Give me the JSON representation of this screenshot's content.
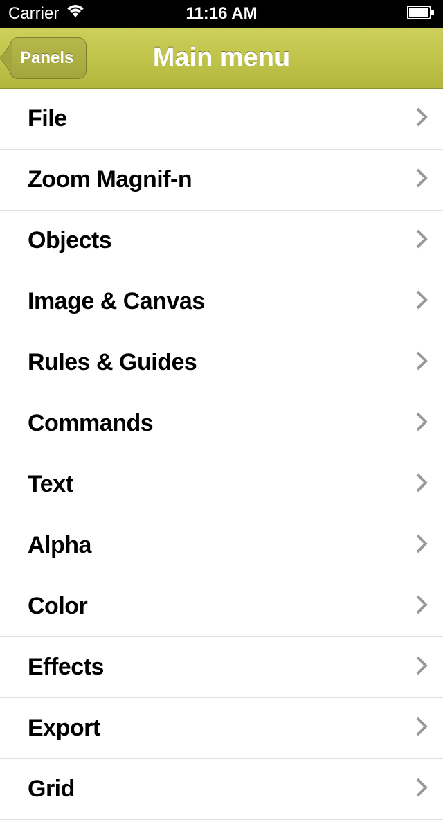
{
  "status": {
    "carrier": "Carrier",
    "time": "11:16 AM"
  },
  "nav": {
    "back_label": "Panels",
    "title": "Main menu"
  },
  "menu": {
    "items": [
      {
        "label": "File"
      },
      {
        "label": "Zoom Magnif-n"
      },
      {
        "label": "Objects"
      },
      {
        "label": "Image & Canvas"
      },
      {
        "label": "Rules & Guides"
      },
      {
        "label": "Commands"
      },
      {
        "label": "Text"
      },
      {
        "label": "Alpha"
      },
      {
        "label": "Color"
      },
      {
        "label": "Effects"
      },
      {
        "label": "Export"
      },
      {
        "label": "Grid"
      }
    ]
  }
}
